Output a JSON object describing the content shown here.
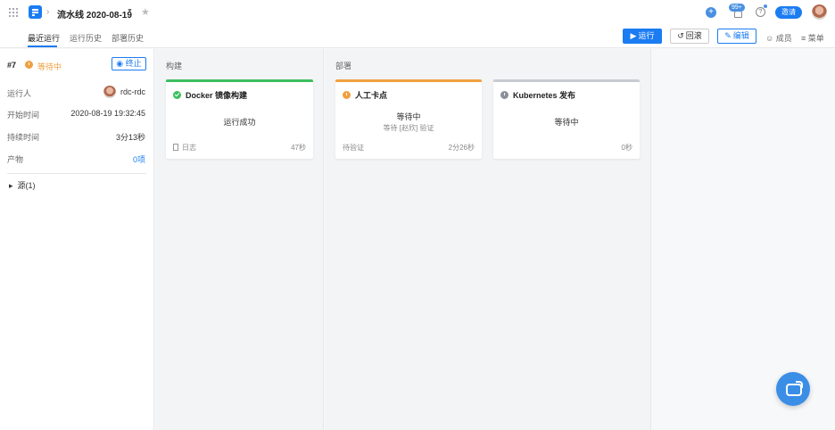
{
  "header": {
    "title": "流水线 2020-08-19",
    "notification_count": "99+",
    "help_glyph": "?",
    "invite_label": "邀请"
  },
  "tabs": [
    {
      "label": "最近运行",
      "active": true
    },
    {
      "label": "运行历史",
      "active": false
    },
    {
      "label": "部署历史",
      "active": false
    }
  ],
  "toolbar": {
    "run_label": "运行",
    "rollback_label": "回滚",
    "edit_label": "编辑",
    "members_label": "成员",
    "menu_label": "菜单"
  },
  "run": {
    "number": "#7",
    "status": "等待中",
    "stop_label": "终止",
    "runner_label": "运行人",
    "runner_value": "rdc-rdc",
    "start_label": "开始时间",
    "start_value": "2020-08-19 19:32:45",
    "duration_label": "持续时间",
    "duration_value": "3分13秒",
    "artifact_label": "产物",
    "artifact_value": "0项",
    "source_label": "源(1)"
  },
  "stages": [
    {
      "title": "构建",
      "jobs": [
        {
          "name": "Docker 镜像构建",
          "status": "success",
          "center": "运行成功",
          "sub": "",
          "foot_left": "日志",
          "foot_right": "47秒"
        }
      ]
    },
    {
      "title": "部署",
      "jobs": [
        {
          "name": "人工卡点",
          "status": "waiting",
          "center": "等待中",
          "sub": "等待 [赵欣] 验证",
          "foot_left": "待验证",
          "foot_right": "2分26秒"
        },
        {
          "name": "Kubernetes 发布",
          "status": "pending",
          "center": "等待中",
          "sub": "",
          "foot_left": "",
          "foot_right": "0秒"
        }
      ]
    }
  ],
  "colors": {
    "accent": "#1b7cf2",
    "success": "#3cbf5e",
    "waiting": "#f0a040",
    "pending": "#c8ccd2"
  },
  "icons": [
    "apps-grid-icon",
    "pipeline-logo-icon",
    "chevron-right-icon",
    "caret-down-icon",
    "star-icon",
    "plus-icon",
    "bell-icon",
    "help-icon",
    "play-icon",
    "rollback-icon",
    "pencil-icon",
    "user-icon",
    "menu-icon",
    "stop-icon",
    "caret-right-icon",
    "doc-icon",
    "chat-icon"
  ]
}
